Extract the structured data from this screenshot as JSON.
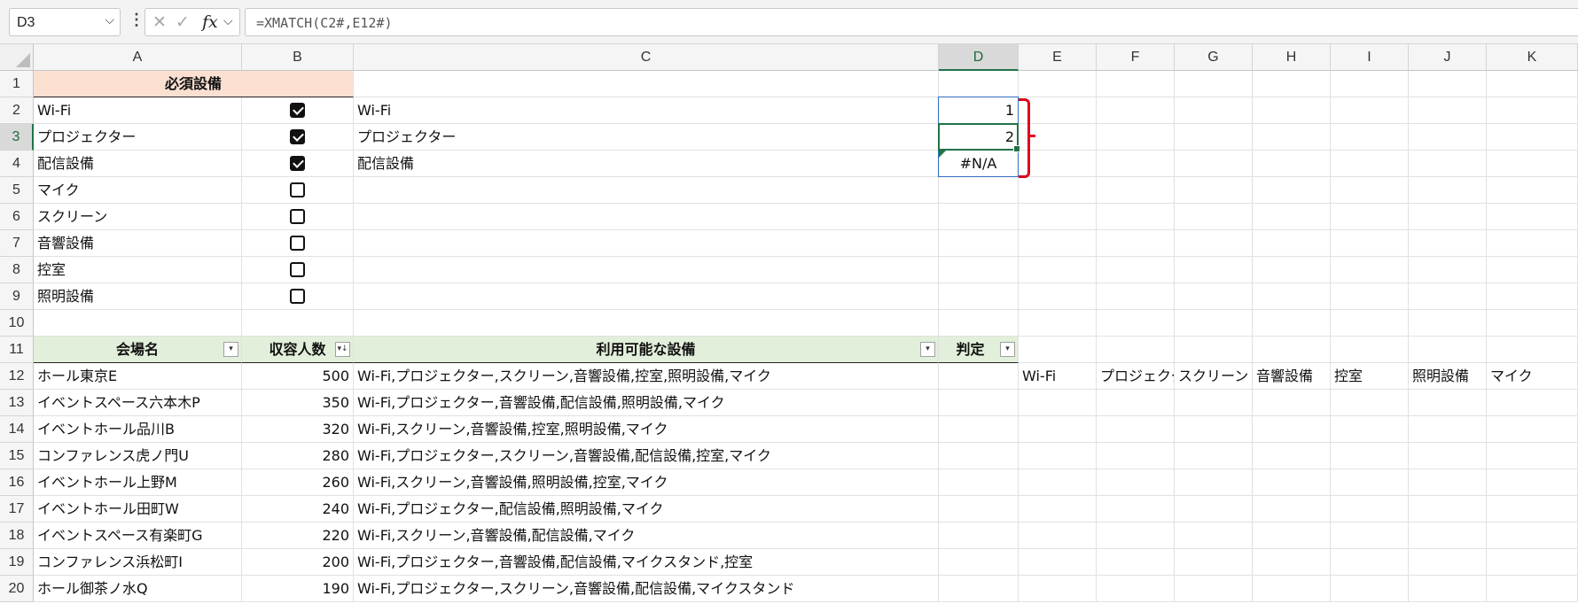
{
  "formula_bar": {
    "name_box": "D3",
    "name_box_arrow": "⌵",
    "menu_dots": "⋮",
    "cancel_icon": "✕",
    "enter_icon": "✓",
    "fx_label": "fx",
    "fx_arrow": "⌵",
    "formula": "=XMATCH(C2#,E12#)"
  },
  "columns": [
    "A",
    "B",
    "C",
    "D",
    "E",
    "F",
    "G",
    "H",
    "I",
    "J",
    "K"
  ],
  "rows": [
    "1",
    "2",
    "3",
    "4",
    "5",
    "6",
    "7",
    "8",
    "9",
    "10",
    "11",
    "12",
    "13",
    "14",
    "15",
    "16",
    "17",
    "18",
    "19",
    "20"
  ],
  "required": {
    "header": "必須設備",
    "items": [
      {
        "name": "Wi-Fi",
        "checked": true
      },
      {
        "name": "プロジェクター",
        "checked": true
      },
      {
        "name": "配信設備",
        "checked": true
      },
      {
        "name": "マイク",
        "checked": false
      },
      {
        "name": "スクリーン",
        "checked": false
      },
      {
        "name": "音響設備",
        "checked": false
      },
      {
        "name": "控室",
        "checked": false
      },
      {
        "name": "照明設備",
        "checked": false
      }
    ]
  },
  "filtered_c": [
    "Wi-Fi",
    "プロジェクター",
    "配信設備"
  ],
  "match_d": [
    "1",
    "2",
    "#N/A"
  ],
  "table": {
    "headers": [
      "会場名",
      "収容人数",
      "利用可能な設備",
      "判定"
    ],
    "filter_icon": "▾",
    "sort_icon": "▾↓",
    "rows": [
      [
        "ホール東京E",
        "500",
        "Wi-Fi,プロジェクター,スクリーン,音響設備,控室,照明設備,マイク"
      ],
      [
        "イベントスペース六本木P",
        "350",
        "Wi-Fi,プロジェクター,音響設備,配信設備,照明設備,マイク"
      ],
      [
        "イベントホール品川B",
        "320",
        "Wi-Fi,スクリーン,音響設備,控室,照明設備,マイク"
      ],
      [
        "コンファレンス虎ノ門U",
        "280",
        "Wi-Fi,プロジェクター,スクリーン,音響設備,配信設備,控室,マイク"
      ],
      [
        "イベントホール上野M",
        "260",
        "Wi-Fi,スクリーン,音響設備,照明設備,控室,マイク"
      ],
      [
        "イベントホール田町W",
        "240",
        "Wi-Fi,プロジェクター,配信設備,照明設備,マイク"
      ],
      [
        "イベントスペース有楽町G",
        "220",
        "Wi-Fi,スクリーン,音響設備,配信設備,マイク"
      ],
      [
        "コンファレンス浜松町I",
        "200",
        "Wi-Fi,プロジェクター,音響設備,配信設備,マイクスタンド,控室"
      ],
      [
        "ホール御茶ノ水Q",
        "190",
        "Wi-Fi,プロジェクター,スクリーン,音響設備,配信設備,マイクスタンド"
      ]
    ]
  },
  "spill_row12": [
    "Wi-Fi",
    "プロジェクター",
    "スクリーン",
    "音響設備",
    "控室",
    "照明設備",
    "マイク"
  ]
}
